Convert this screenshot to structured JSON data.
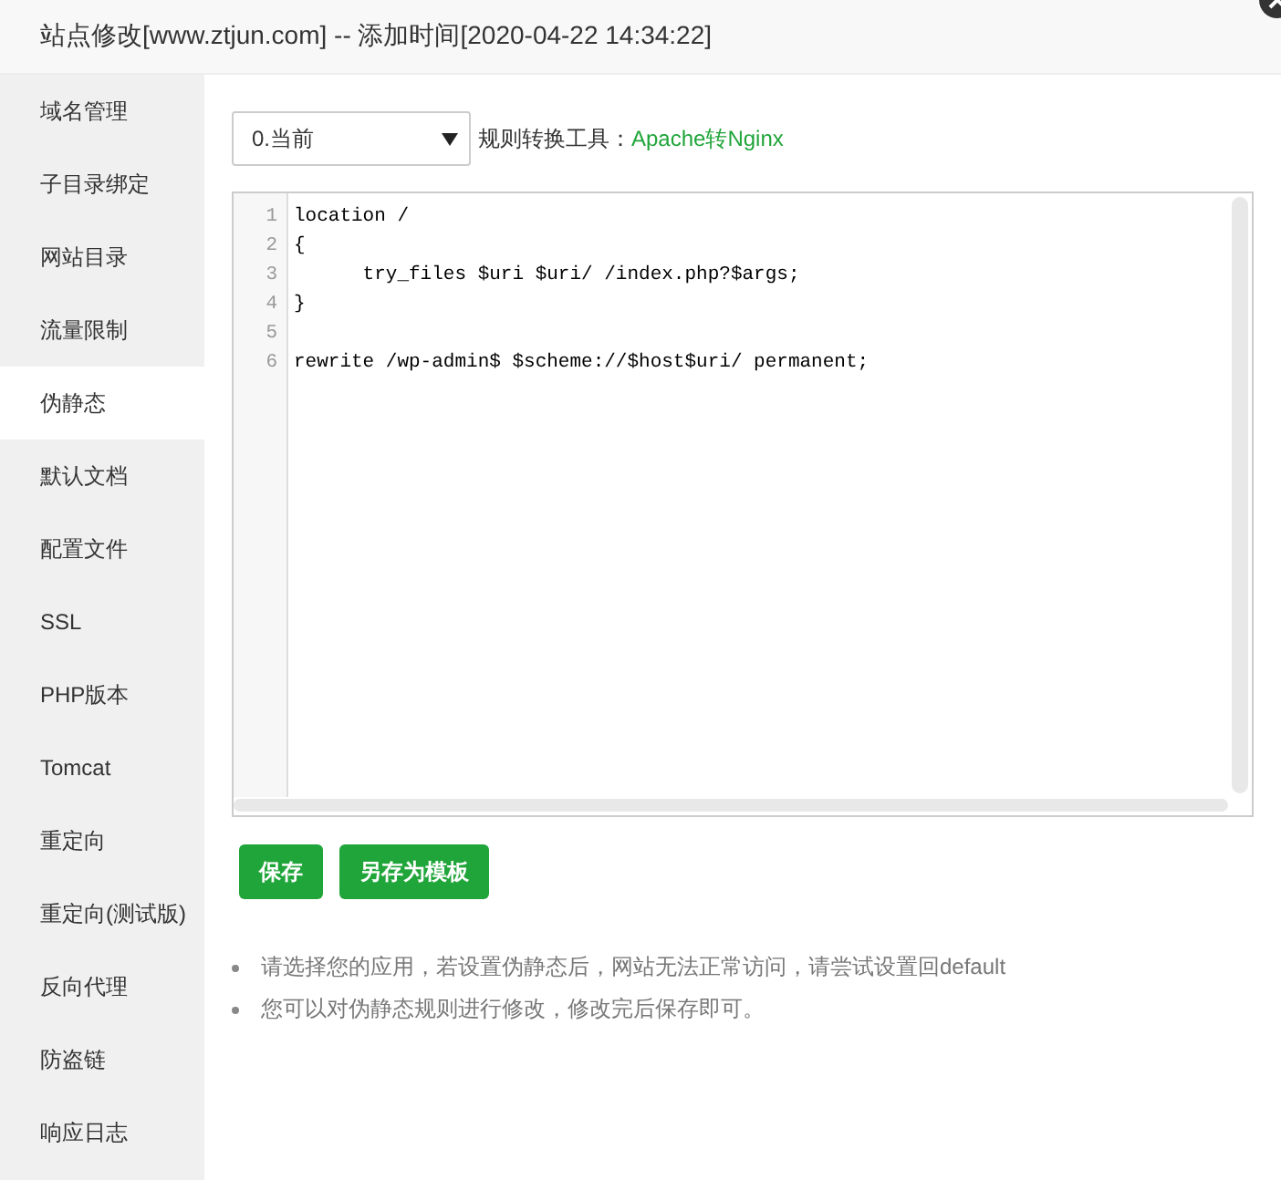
{
  "window": {
    "title": "站点修改[www.ztjun.com] -- 添加时间[2020-04-22 14:34:22]"
  },
  "sidebar": {
    "items": [
      {
        "label": "域名管理",
        "selected": false
      },
      {
        "label": "子目录绑定",
        "selected": false
      },
      {
        "label": "网站目录",
        "selected": false
      },
      {
        "label": "流量限制",
        "selected": false
      },
      {
        "label": "伪静态",
        "selected": true
      },
      {
        "label": "默认文档",
        "selected": false
      },
      {
        "label": "配置文件",
        "selected": false
      },
      {
        "label": "SSL",
        "selected": false
      },
      {
        "label": "PHP版本",
        "selected": false
      },
      {
        "label": "Tomcat",
        "selected": false
      },
      {
        "label": "重定向",
        "selected": false
      },
      {
        "label": "重定向(测试版)",
        "selected": false
      },
      {
        "label": "反向代理",
        "selected": false
      },
      {
        "label": "防盗链",
        "selected": false
      },
      {
        "label": "响应日志",
        "selected": false
      }
    ]
  },
  "toolbar": {
    "template_select": {
      "value": "0.当前"
    },
    "converter_label": "规则转换工具：",
    "converter_link": "Apache转Nginx"
  },
  "editor": {
    "lines": [
      {
        "number": "1",
        "text": "location /"
      },
      {
        "number": "2",
        "text": "{"
      },
      {
        "number": "3",
        "text": "      try_files $uri $uri/ /index.php?$args;"
      },
      {
        "number": "4",
        "text": "}"
      },
      {
        "number": "5"
      },
      {
        "number": "6",
        "text": "rewrite /wp-admin$ $scheme://$host$uri/ permanent;"
      }
    ]
  },
  "buttons": [
    "保存",
    "另存为模板"
  ],
  "notes": [
    "请选择您的应用，若设置伪静态后，网站无法正常访问，请尝试设置回default",
    "您可以对伪静态规则进行修改，修改完后保存即可。"
  ]
}
